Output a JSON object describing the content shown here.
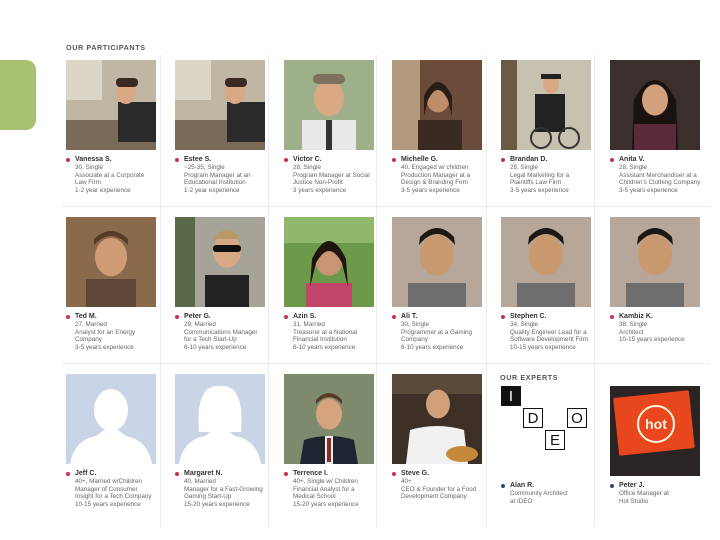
{
  "header": {
    "participants_title": "OUR PARTICIPANTS",
    "experts_title": "OUR EXPERTS"
  },
  "colors": {
    "accent_tab": "#a8c170",
    "participant_dot": "#c8334a",
    "expert_dot": "#2c4a6e"
  },
  "participants": [
    {
      "name": "Vanessa S.",
      "desc": "30, Single\nAssociate at a Corporate\nLaw Firm\n1-2 year experience",
      "photo": "person-at-desk"
    },
    {
      "name": "Estee S.",
      "desc": "~25-35, Single\nProgram Manager at an\nEducational Institution\n1-2 year experience",
      "photo": "person-at-desk"
    },
    {
      "name": "Victor C.",
      "desc": "28, Single\nProgram Manager at Social\nJustice Non-Profit\n3 years experience",
      "photo": "smiling-man-cap"
    },
    {
      "name": "Michelle G.",
      "desc": "40, Engaged w/ children\nProduction Manager at a\nDesign & Branding Firm\n3-5 years experience",
      "photo": "woman-indoors"
    },
    {
      "name": "Brandan D.",
      "desc": "28, Single\nLegal Marketing for a\nPlaintiffs Law Firm\n3-5 years experience",
      "photo": "man-with-bicycle"
    },
    {
      "name": "Anita V.",
      "desc": "28, Single\nAssistant Merchandiser at a\nChildren's Clothing Company\n3-5 years experience",
      "photo": "smiling-woman"
    },
    {
      "name": "Ted M.",
      "desc": "27, Married\nAnalyst for an Energy\nCompany\n3-5 years experience",
      "photo": "smiling-man"
    },
    {
      "name": "Peter G.",
      "desc": "29, Married\nCommunications Manager\nfor a Tech Start-Up\n6-10 years experience",
      "photo": "man-sunglasses"
    },
    {
      "name": "Azin S.",
      "desc": "31, Married\nTreasurer at a National\nFinancial Institution\n6-10 years experience",
      "photo": "woman-outdoors"
    },
    {
      "name": "Ali T.",
      "desc": "30, Single\nProgrammer at a Gaming\nCompany\n6-10 years experience",
      "photo": "man-portrait"
    },
    {
      "name": "Stephen C.",
      "desc": "34, Single\nQuality Engineer Lead for a\nSoftware Development Firm\n10-15 years experience",
      "photo": "man-portrait"
    },
    {
      "name": "Kambiz K.",
      "desc": "38, Single\nArchitect\n10-15 years experience",
      "photo": "man-portrait"
    },
    {
      "name": "Jeff C.",
      "desc": "40+, Married w/Children\nManager of Consumer\nInsight for a Tech Company\n10-15 years experience",
      "photo": "silhouette-male"
    },
    {
      "name": "Margaret N.",
      "desc": "40, Married\nManager for a Fast-Growing\nGaming Start-Up\n15-20 years experience",
      "photo": "silhouette-female"
    },
    {
      "name": "Terrence I.",
      "desc": "40+, Single w/ Children\nFinancial Analyst for a\nMedical School\n15-20 years experience",
      "photo": "man-in-suit"
    },
    {
      "name": "Steve G.",
      "desc": "40+\nCEO & Founder for a Food\nDevelopment Company",
      "photo": "man-white-shirt"
    }
  ],
  "experts": [
    {
      "name": "Alan R.",
      "desc": "Community Architect\nat IDEO",
      "photo": "ideo-logo"
    },
    {
      "name": "Peter J.",
      "desc": "Office Manager at\nHot Studio",
      "photo": "hot-studio-sign"
    }
  ],
  "ideo_logo": {
    "letters": [
      "I",
      "D",
      "E",
      "O"
    ]
  },
  "hot_sign": {
    "text": "hot"
  }
}
